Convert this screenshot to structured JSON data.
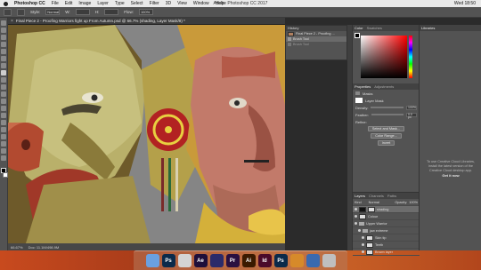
{
  "menubar": {
    "app_name": "Photoshop CC",
    "items": [
      "File",
      "Edit",
      "Image",
      "Layer",
      "Type",
      "Select",
      "Filter",
      "3D",
      "View",
      "Window",
      "Help"
    ],
    "window_title": "Adobe Photoshop CC 2017",
    "clock": "Wed 18:50"
  },
  "options": {
    "style_label": "Style:",
    "style_value": "Normal",
    "width_label": "W:",
    "height_label": "H:",
    "flow_label": "Flow:",
    "flow_value": "100%"
  },
  "document": {
    "tab_title": "Final Piece 2 - Proofing Warriors fight up From Autumn.psd @ 66.7% (shading, Layer Mask/8) *",
    "status_zoom": "66.67%",
    "status_doc": "Doc: 11.1M/498.9M"
  },
  "history": {
    "tab": "History",
    "rows": [
      {
        "label": "Final Piece 2 - Proofing ..."
      },
      {
        "label": "Brush Tool"
      },
      {
        "label": "Brush Tool"
      }
    ]
  },
  "color_panel": {
    "tabs": [
      "Color",
      "Swatches"
    ],
    "fg_color": "#000000",
    "hue_color": "#ff0000"
  },
  "properties": {
    "tabs": [
      "Properties",
      "Adjustments"
    ],
    "section": "Masks",
    "layer_mask": "Layer Mask",
    "density_label": "Density:",
    "density_value": "100%",
    "feather_label": "Feather:",
    "feather_value": "0.0 px",
    "refine_label": "Refine:",
    "select_mask_btn": "Select and Mask...",
    "color_range_btn": "Color Range...",
    "invert_btn": "Invert"
  },
  "layers": {
    "tabs": [
      "Layers",
      "Channels",
      "Paths"
    ],
    "kind_label": "Kind",
    "blend_mode": "Normal",
    "opacity_label": "Opacity:",
    "opacity_value": "100%",
    "rows": [
      {
        "name": "shading",
        "thumb": "dark"
      },
      {
        "name": "Colour",
        "thumb": "light"
      },
      {
        "name": "Upper Warrior",
        "thumb": "folder"
      },
      {
        "name": "jaw extreme",
        "thumb": "folder"
      },
      {
        "name": "Skin tip",
        "thumb": "light"
      },
      {
        "name": "Teeth",
        "thumb": "light"
      },
      {
        "name": "Brown layer",
        "thumb": "light"
      }
    ]
  },
  "libraries": {
    "tab": "Libraries",
    "info_text": "To use Creative Cloud Libraries, install the latest version of the Creative Cloud desktop app.",
    "link": "Get it now"
  },
  "dock": {
    "apps": [
      {
        "label": "",
        "icon": "finder-icon",
        "color": "#6aa0e0"
      },
      {
        "label": "Ps",
        "icon": "photoshop-icon",
        "color": "#0b2a4a"
      },
      {
        "label": "",
        "icon": "indesign-orange-icon",
        "color": "#d4d4d4"
      },
      {
        "label": "Ae",
        "icon": "after-effects-icon",
        "color": "#1f0f3a"
      },
      {
        "label": "",
        "icon": "audio-icon",
        "color": "#2b2b6a"
      },
      {
        "label": "Pr",
        "icon": "premiere-icon",
        "color": "#2a1040"
      },
      {
        "label": "Ai",
        "icon": "illustrator-icon",
        "color": "#3a1a00"
      },
      {
        "label": "Id",
        "icon": "indesign-icon",
        "color": "#4a0a2a"
      },
      {
        "label": "Ps",
        "icon": "photoshop2-icon",
        "color": "#0b2a4a"
      },
      {
        "label": "",
        "icon": "bridge-icon",
        "color": "#d68a2a"
      },
      {
        "label": "",
        "icon": "quicktime-icon",
        "color": "#3a6ab0"
      },
      {
        "label": "",
        "icon": "trash-icon",
        "color": "#bfbfbf"
      }
    ]
  }
}
